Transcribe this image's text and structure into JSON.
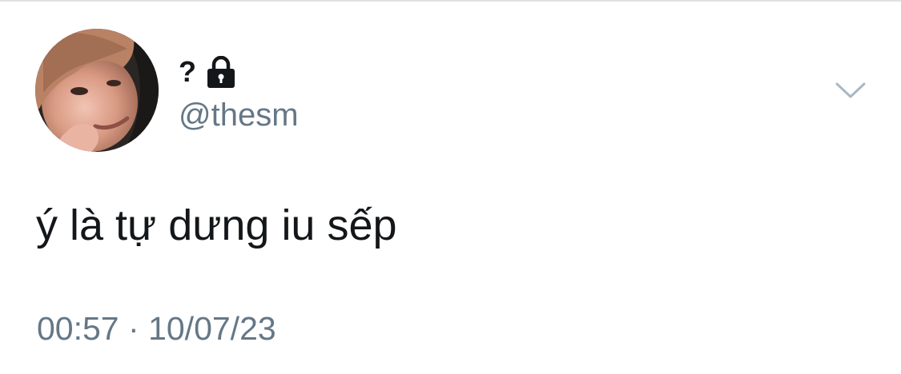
{
  "tweet": {
    "display_name": "?",
    "lock_icon": "lock-icon",
    "handle": "@thesm",
    "text": "ý là tự dưng iu sếp",
    "time": "00:57",
    "separator": "·",
    "date": "10/07/23",
    "menu_icon": "chevron-down-icon"
  },
  "colors": {
    "text_primary": "#14171a",
    "text_secondary": "#657786",
    "chevron": "#aab8c2",
    "divider": "#e1e1e1"
  }
}
